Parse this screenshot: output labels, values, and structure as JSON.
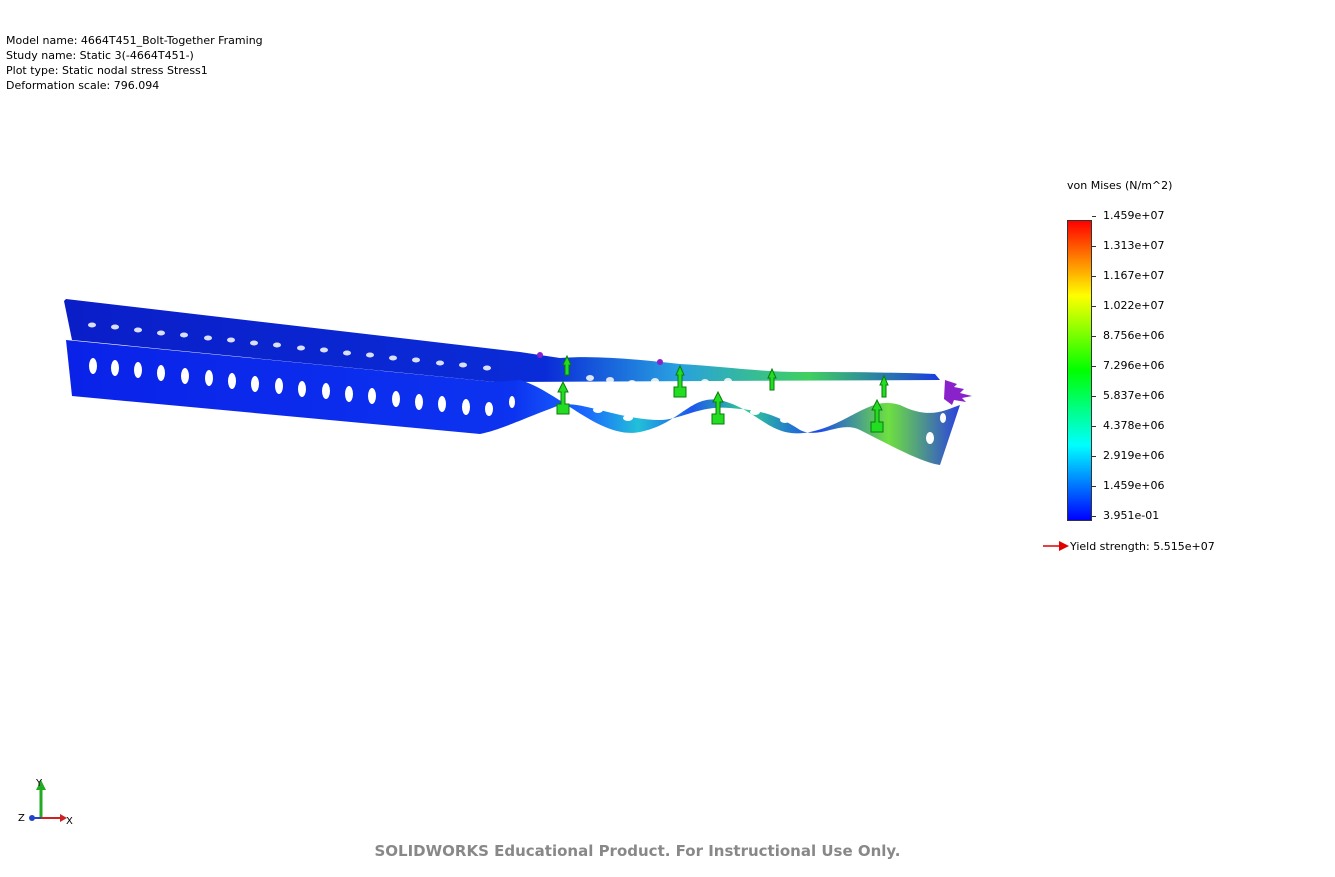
{
  "info": {
    "model_name": "Model name: 4664T451_Bolt-Together Framing",
    "study_name": "Study name: Static 3(-4664T451-)",
    "plot_type": "Plot type: Static nodal stress Stress1",
    "deformation_scale": "Deformation scale: 796.094"
  },
  "legend": {
    "title": "von Mises (N/m^2)",
    "ticks": [
      "1.459e+07",
      "1.313e+07",
      "1.167e+07",
      "1.022e+07",
      "8.756e+06",
      "7.296e+06",
      "5.837e+06",
      "4.378e+06",
      "2.919e+06",
      "1.459e+06",
      "3.951e-01"
    ],
    "yield_label": "Yield strength: 5.515e+07",
    "colors": [
      "#ff0000",
      "#ff8000",
      "#ffff00",
      "#80ff00",
      "#00ff00",
      "#00ff80",
      "#00ffff",
      "#0080ff",
      "#0000ff"
    ]
  },
  "triad": {
    "y": "Y",
    "x": "X",
    "z": "Z"
  },
  "watermark": "SOLIDWORKS Educational Product. For Instructional Use Only."
}
